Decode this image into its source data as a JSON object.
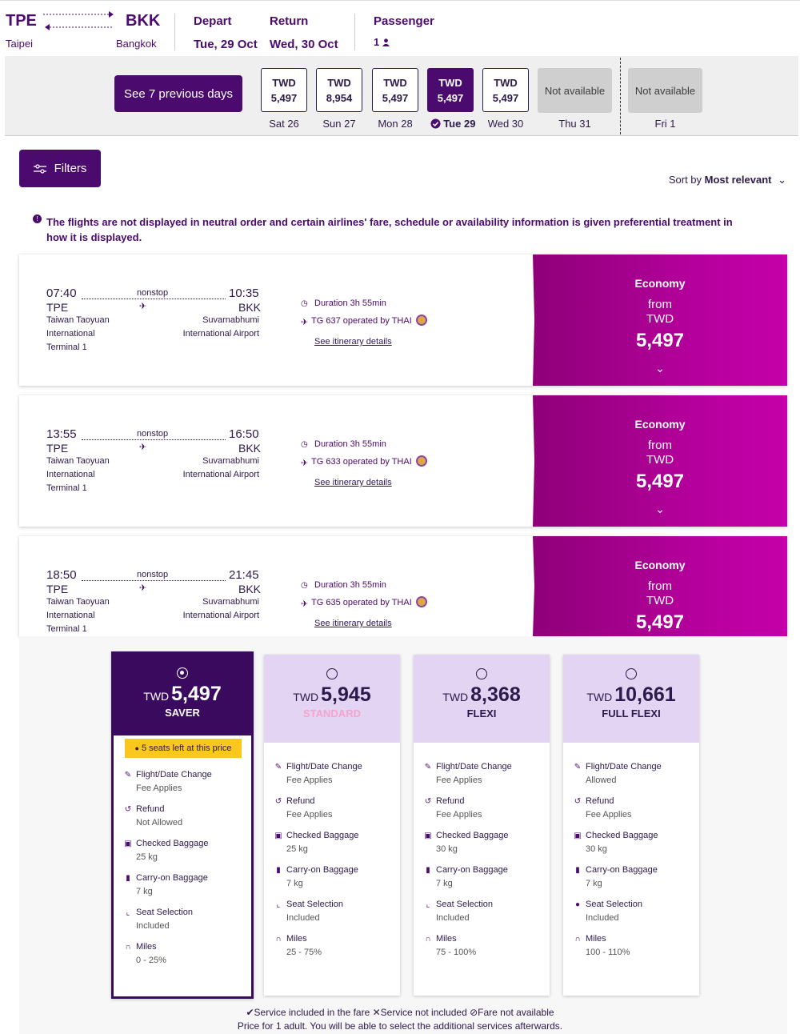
{
  "header": {
    "origin_code": "TPE",
    "origin_city": "Taipei",
    "dest_code": "BKK",
    "dest_city": "Bangkok",
    "depart_label": "Depart",
    "depart_value": "Tue, 29 Oct",
    "return_label": "Return",
    "return_value": "Wed, 30 Oct",
    "passenger_label": "Passenger",
    "passenger_value": "1"
  },
  "datebar": {
    "prev_label": "See 7 previous days",
    "days": [
      {
        "cur": "TWD",
        "price": "5,497",
        "label": "Sat 26"
      },
      {
        "cur": "TWD",
        "price": "8,954",
        "label": "Sun 27"
      },
      {
        "cur": "TWD",
        "price": "5,497",
        "label": "Mon 28"
      },
      {
        "cur": "TWD",
        "price": "5,497",
        "label": "Tue 29"
      },
      {
        "cur": "TWD",
        "price": "5,497",
        "label": "Wed 30"
      },
      {
        "text": "Not available",
        "label": "Thu 31"
      },
      {
        "text": "Not available",
        "label": "Fri 1"
      }
    ]
  },
  "filters_label": "Filters",
  "sort": {
    "prefix": "Sort by",
    "value": "Most relevant"
  },
  "notice": "The flights are not displayed in neutral order and certain airlines' fare, schedule or availability information is given preferential treatment in how it is displayed.",
  "flights": [
    {
      "dep_time": "07:40",
      "arr_time": "10:35",
      "stop": "nonstop",
      "dep_code": "TPE",
      "arr_code": "BKK",
      "dep_airport1": "Taiwan Taoyuan",
      "dep_airport2": "International",
      "dep_terminal": "Terminal 1",
      "arr_airport1": "Suvarnabhumi",
      "arr_airport2": "International Airport",
      "duration": "Duration 3h 55min",
      "operated": "TG 637 operated by THAI",
      "details": "See itinerary details",
      "cabin": "Economy",
      "from": "from",
      "cur": "TWD",
      "price": "5,497"
    },
    {
      "dep_time": "13:55",
      "arr_time": "16:50",
      "stop": "nonstop",
      "dep_code": "TPE",
      "arr_code": "BKK",
      "dep_airport1": "Taiwan Taoyuan",
      "dep_airport2": "International",
      "dep_terminal": "Terminal 1",
      "arr_airport1": "Suvarnabhumi",
      "arr_airport2": "International Airport",
      "duration": "Duration 3h 55min",
      "operated": "TG 633 operated by THAI",
      "details": "See itinerary details",
      "cabin": "Economy",
      "from": "from",
      "cur": "TWD",
      "price": "5,497"
    },
    {
      "dep_time": "18:50",
      "arr_time": "21:45",
      "stop": "nonstop",
      "dep_code": "TPE",
      "arr_code": "BKK",
      "dep_airport1": "Taiwan Taoyuan",
      "dep_airport2": "International",
      "dep_terminal": "Terminal 1",
      "arr_airport1": "Suvarnabhumi",
      "arr_airport2": "International Airport",
      "duration": "Duration 3h 55min",
      "operated": "TG 635 operated by THAI",
      "details": "See itinerary details",
      "cabin": "Economy",
      "from": "from",
      "cur": "TWD",
      "price": "5,497"
    }
  ],
  "fares": [
    {
      "cur": "TWD",
      "price": "5,497",
      "name": "SAVER",
      "badge": "5 seats left at this price",
      "features": [
        {
          "t": "Flight/Date Change",
          "v": "Fee Applies"
        },
        {
          "t": "Refund",
          "v": "Not Allowed"
        },
        {
          "t": "Checked Baggage",
          "v": "25 kg"
        },
        {
          "t": "Carry-on Baggage",
          "v": "7 kg"
        },
        {
          "t": "Seat Selection",
          "v": "Included"
        },
        {
          "t": "Miles",
          "v": "0 - 25%"
        }
      ]
    },
    {
      "cur": "TWD",
      "price": "5,945",
      "name": "STANDARD",
      "features": [
        {
          "t": "Flight/Date Change",
          "v": "Fee Applies"
        },
        {
          "t": "Refund",
          "v": "Fee Applies"
        },
        {
          "t": "Checked Baggage",
          "v": "25 kg"
        },
        {
          "t": "Carry-on Baggage",
          "v": "7 kg"
        },
        {
          "t": "Seat Selection",
          "v": "Included"
        },
        {
          "t": "Miles",
          "v": "25 - 75%"
        }
      ]
    },
    {
      "cur": "TWD",
      "price": "8,368",
      "name": "FLEXI",
      "features": [
        {
          "t": "Flight/Date Change",
          "v": "Fee Applies"
        },
        {
          "t": "Refund",
          "v": "Fee Applies"
        },
        {
          "t": "Checked Baggage",
          "v": "30 kg"
        },
        {
          "t": "Carry-on Baggage",
          "v": "7 kg"
        },
        {
          "t": "Seat Selection",
          "v": "Included"
        },
        {
          "t": "Miles",
          "v": "75 - 100%"
        }
      ]
    },
    {
      "cur": "TWD",
      "price": "10,661",
      "name": "FULL FLEXI",
      "features": [
        {
          "t": "Flight/Date Change",
          "v": "Allowed"
        },
        {
          "t": "Refund",
          "v": "Fee Applies"
        },
        {
          "t": "Checked Baggage",
          "v": "30 kg"
        },
        {
          "t": "Carry-on Baggage",
          "v": "7 kg"
        },
        {
          "t": "Seat Selection",
          "v": "Included"
        },
        {
          "t": "Miles",
          "v": "100 - 110%"
        }
      ]
    }
  ],
  "legend": {
    "included": "Service included in the fare",
    "not_included": "Service not included",
    "not_available": "Fare not available"
  },
  "price_note": "Price for 1 adult. You will be able to select the additional services afterwards.",
  "colors": {
    "primary": "#4b0a6e",
    "economy": "#b3009b",
    "badge": "#fbc71c"
  }
}
